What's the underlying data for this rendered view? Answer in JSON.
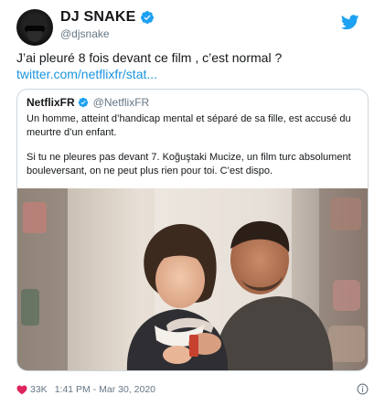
{
  "author": {
    "display_name": "DJ SNAKE",
    "handle": "@djsnake"
  },
  "tweet": {
    "text": "J’ai pleuré 8 fois devant ce film , c’est normal ?",
    "link": "twitter.com/netflixfr/stat..."
  },
  "quoted": {
    "display_name": "NetflixFR",
    "handle": "@NetflixFR",
    "text_1": "Un homme, atteint d’handicap mental et séparé de sa fille, est accusé du meurtre d’un enfant.",
    "text_2": "Si tu ne pleures pas devant 7. Koğuştaki Mucize, un film turc absolument bouleversant, on ne peut plus rien pour toi. C’est dispo."
  },
  "footer": {
    "likes": "33K",
    "timestamp": "1:41 PM - Mar 30, 2020"
  },
  "colors": {
    "link": "#1b95e0",
    "verified": "#1da1f2",
    "like_heart": "#e0245e",
    "muted": "#657786"
  },
  "icons": {
    "verified": "verified-badge-icon",
    "brand": "twitter-bird-icon",
    "like": "heart-icon",
    "info": "info-icon"
  }
}
